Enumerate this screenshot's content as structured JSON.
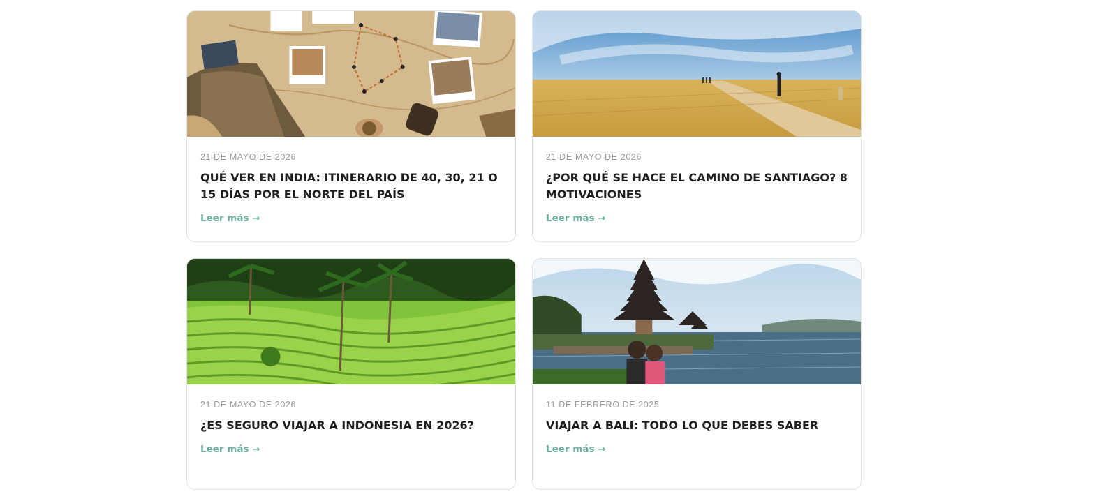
{
  "posts": [
    {
      "image": "india-travel-map-image",
      "date": "21 DE MAYO DE 2026",
      "title": "QUÉ VER EN INDIA: ITINERARIO DE 40, 30, 21 O 15 DÍAS POR EL NORTE DEL PAÍS",
      "more": "Leer más →"
    },
    {
      "image": "camino-de-santiago-field-image",
      "date": "21 DE MAYO DE 2026",
      "title": "¿POR QUÉ SE HACE EL CAMINO DE SANTIAGO? 8 MOTIVACIONES",
      "more": "Leer más →"
    },
    {
      "image": "indonesia-rice-terraces-image",
      "date": "21 DE MAYO DE 2026",
      "title": "¿ES SEGURO VIAJAR A INDONESIA EN 2026?",
      "more": "Leer más →"
    },
    {
      "image": "bali-temple-lake-image",
      "date": "11 DE FEBRERO DE 2025",
      "title": "VIAJAR A BALI: TODO LO QUE DEBES SABER",
      "more": "Leer más →"
    }
  ],
  "colors": {
    "link": "#6db0a2",
    "title": "#1f1f1f",
    "date": "#9a9a9a",
    "border": "#e3e3e3"
  }
}
